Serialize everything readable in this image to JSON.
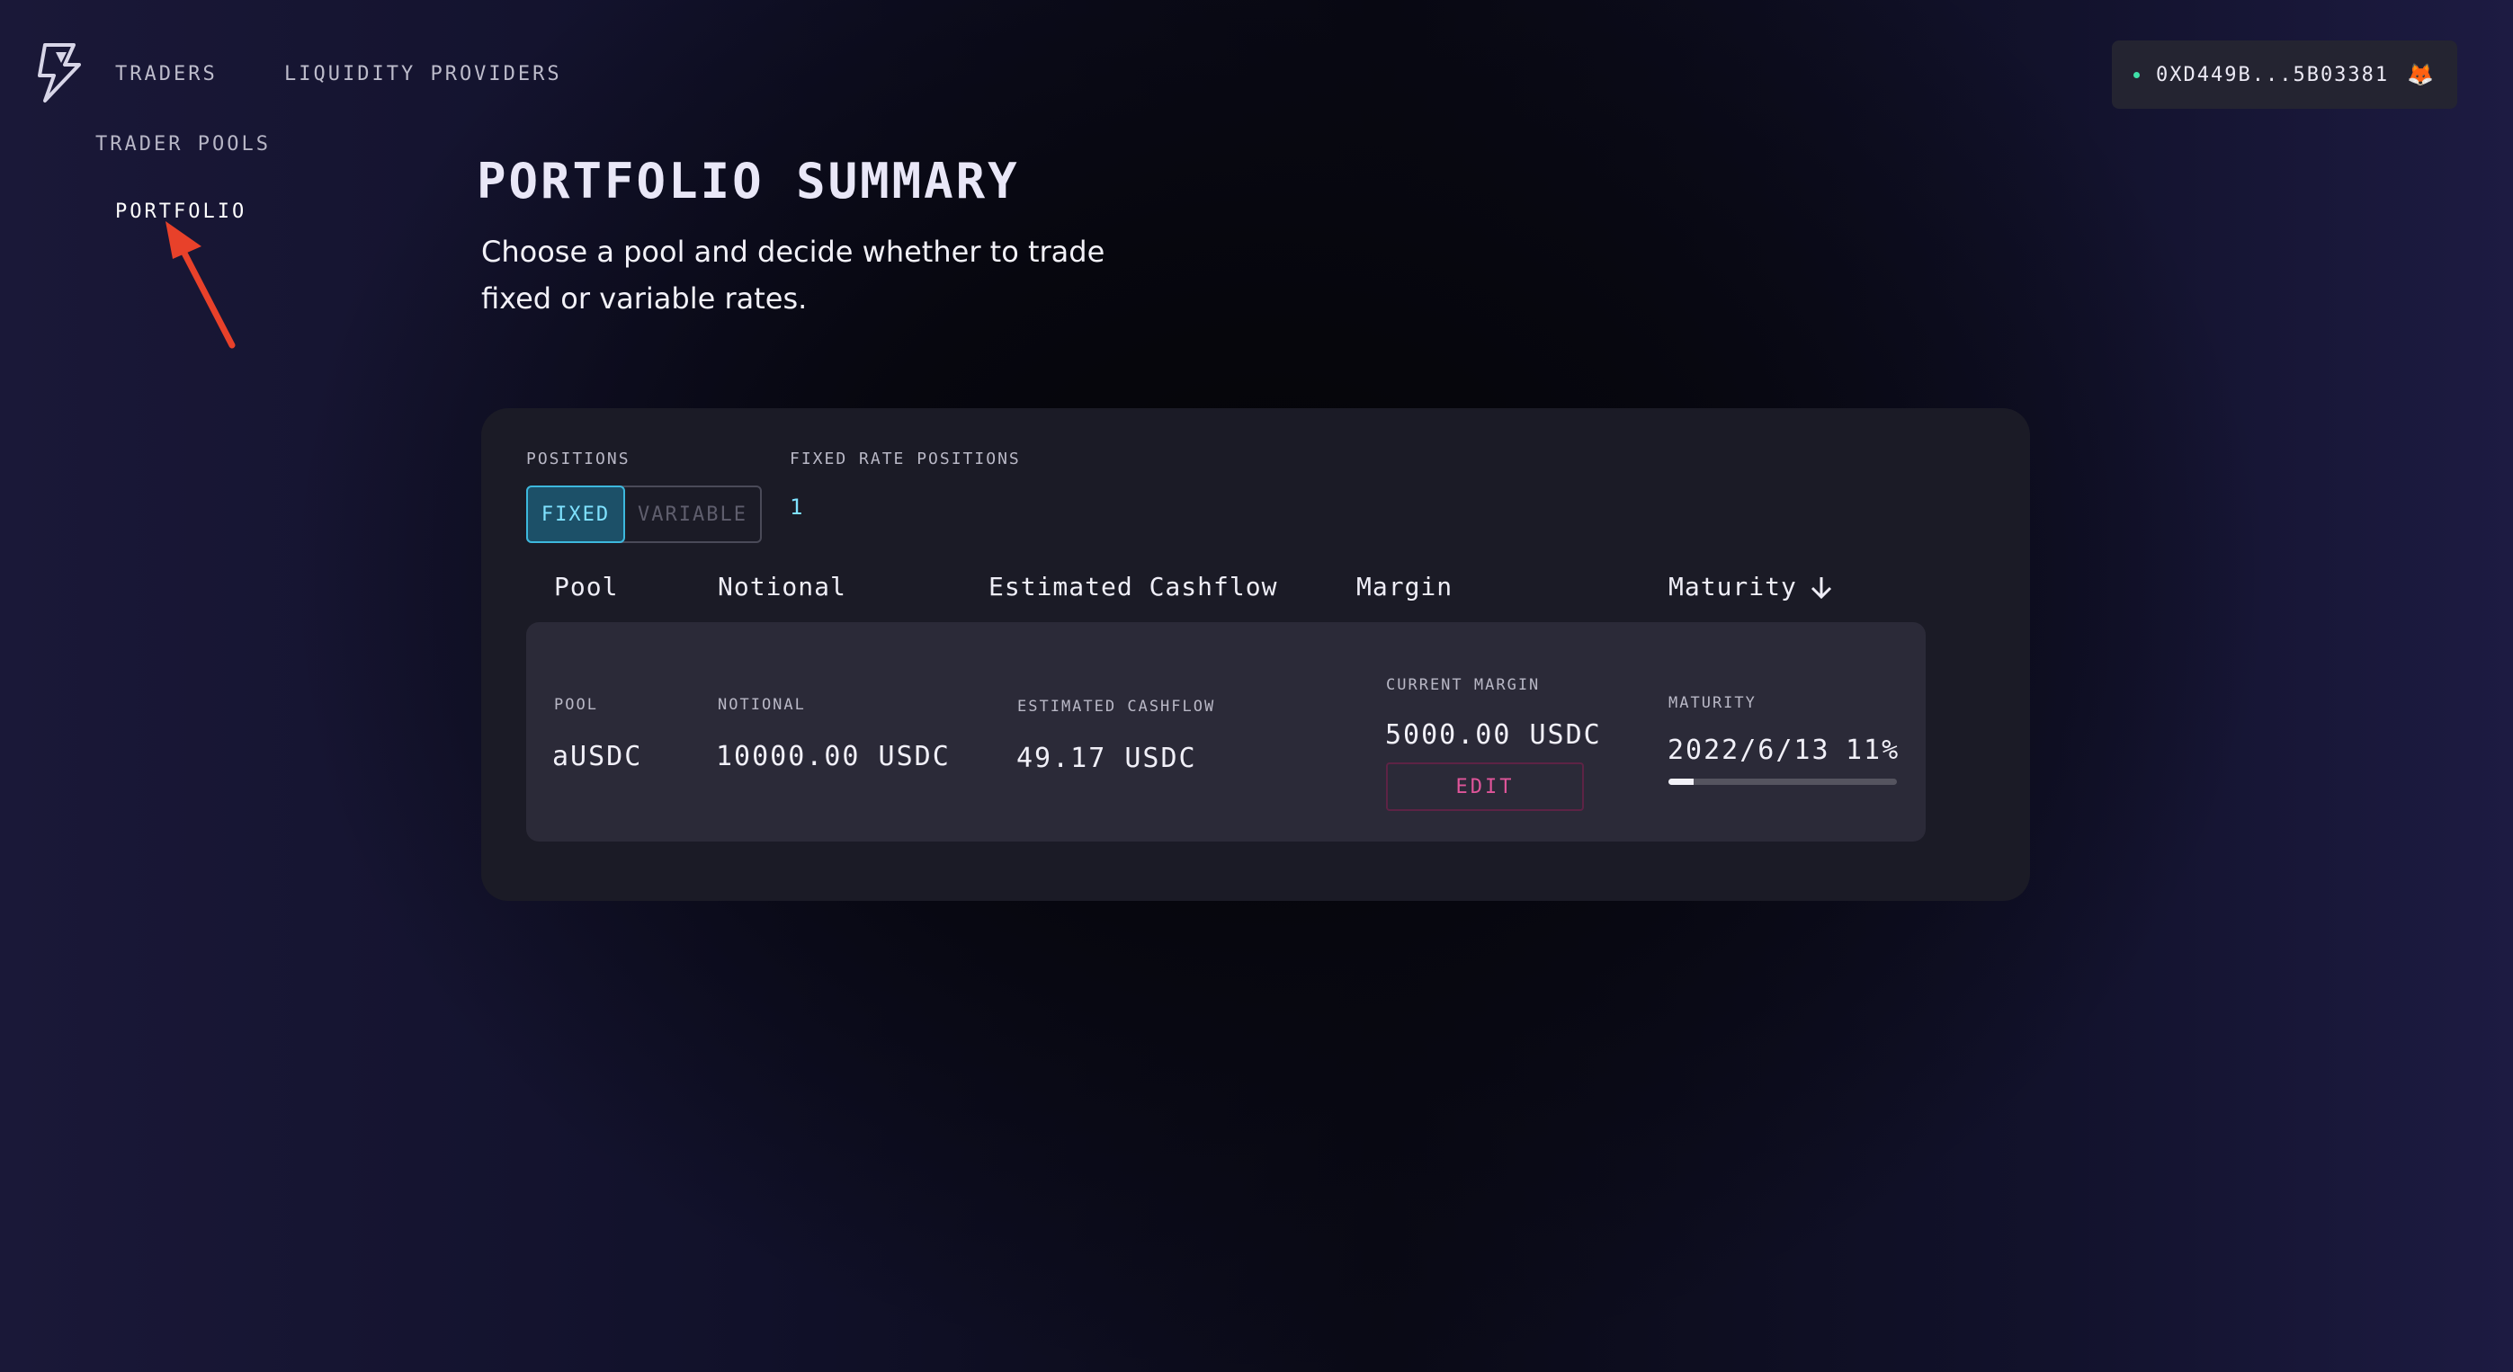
{
  "nav": {
    "traders": "TRADERS",
    "liquidity_providers": "LIQUIDITY PROVIDERS",
    "trader_pools": "TRADER POOLS",
    "portfolio": "PORTFOLIO"
  },
  "wallet": {
    "address": "0XD449B...5B03381",
    "icon": "metamask-fox-icon"
  },
  "page": {
    "title": "PORTFOLIO SUMMARY",
    "subtitle_line1": "Choose a pool and decide whether to trade",
    "subtitle_line2": "fixed or variable rates."
  },
  "positions": {
    "label": "POSITIONS",
    "fixed": "FIXED",
    "variable": "VARIABLE",
    "fixed_rate_label": "FIXED RATE POSITIONS",
    "fixed_rate_count": "1"
  },
  "table": {
    "headers": {
      "pool": "Pool",
      "notional": "Notional",
      "cashflow": "Estimated Cashflow",
      "margin": "Margin",
      "maturity": "Maturity"
    },
    "row": {
      "pool_label": "POOL",
      "pool": "aUSDC",
      "notional_label": "NOTIONAL",
      "notional": "10000.00 USDC",
      "cashflow_label": "ESTIMATED CASHFLOW",
      "cashflow": "49.17 USDC",
      "margin_label": "CURRENT MARGIN",
      "margin": "5000.00 USDC",
      "edit": "EDIT",
      "maturity_label": "MATURITY",
      "maturity_date": "2022/6/13",
      "maturity_pct": "11%",
      "maturity_progress": 0.11
    }
  },
  "colors": {
    "accent": "#3db8dd",
    "edit": "#e0559a",
    "annotation_arrow": "#e8412a"
  }
}
